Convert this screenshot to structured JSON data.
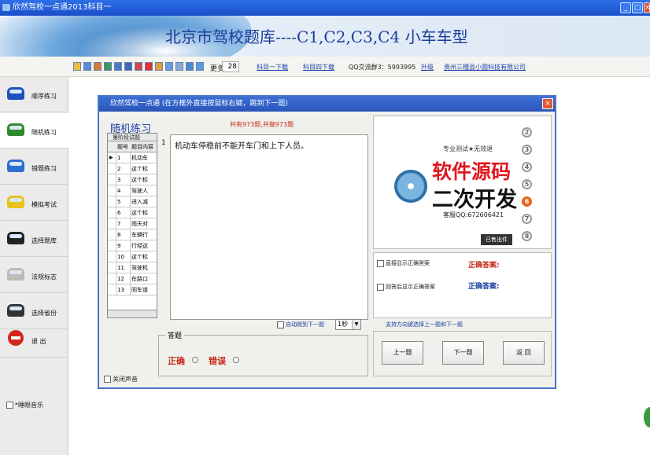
{
  "titlebar": {
    "title": "欣然驾校一点通2013科目一"
  },
  "banner": {
    "title": "北京市驾校题库----C1,C2,C3,C4 小车车型"
  },
  "toolbar": {
    "more_label": "更多",
    "page_value": "28",
    "links": [
      "科目一下载",
      "科目四下载",
      "升级",
      "贵州三穗县小圆科技有限公司"
    ],
    "qq_label": "QQ交流群3：5993995"
  },
  "sidebar": {
    "items": [
      {
        "label": "顺序练习",
        "color": "#1d4fc0"
      },
      {
        "label": "随机练习",
        "color": "#2e8a2e"
      },
      {
        "label": "错题练习",
        "color": "#2b6fd0"
      },
      {
        "label": "模拟考试",
        "color": "#e6c318"
      },
      {
        "label": "选择题库",
        "color": "#222222"
      },
      {
        "label": "法规标志",
        "color": "#bbbbbb"
      },
      {
        "label": "选择省份",
        "color": "#333333"
      },
      {
        "label": "退 出",
        "color": "#d4261c"
      }
    ],
    "music_label": "*睡眼音乐"
  },
  "dialog": {
    "title": "欣然驾校一点通   (在方框外直接按鼠标右键，跳到下一题)",
    "panel_title": "随机练习",
    "count_label": "共有973题,共做973题",
    "grid": {
      "header": "第阶段试题",
      "col_no": "题号",
      "col_content": "题目内容",
      "rows": [
        {
          "no": "1",
          "text": "机动车"
        },
        {
          "no": "2",
          "text": "这个标"
        },
        {
          "no": "3",
          "text": "这个标"
        },
        {
          "no": "4",
          "text": "驾驶人"
        },
        {
          "no": "5",
          "text": "进入减"
        },
        {
          "no": "6",
          "text": "这个标"
        },
        {
          "no": "7",
          "text": "雨天对"
        },
        {
          "no": "8",
          "text": "车辆行"
        },
        {
          "no": "9",
          "text": "行经这"
        },
        {
          "no": "10",
          "text": "这个标"
        },
        {
          "no": "11",
          "text": "驾驶机"
        },
        {
          "no": "12",
          "text": "在路口"
        },
        {
          "no": "13",
          "text": "同车道"
        }
      ]
    },
    "question_number": "1",
    "question_text": "机动车停稳前不能开车门和上下人员。",
    "ad": {
      "top": "专业测试★无效退",
      "line1": "软件源码",
      "line2": "二次开发",
      "qq": "客服QQ:672606421",
      "sold": "已售出件",
      "numbers": [
        "2",
        "3",
        "4",
        "5",
        "6",
        "7",
        "8"
      ]
    },
    "show_correct_label": "直接显示正确答案",
    "show_after_label": "回答后显示正确答案",
    "correct_answer_label": "正确答案:",
    "auto_next_label": "自动跳到下一题",
    "delay_value": "1秒",
    "answer_group_label": "答题",
    "option_correct": "正确",
    "option_wrong": "错误",
    "hint": "支持方向键选择上一题和下一题",
    "prev_button": "上一题",
    "next_button": "下一题",
    "back_button": "返 回",
    "mute_label": "关闭声音"
  }
}
